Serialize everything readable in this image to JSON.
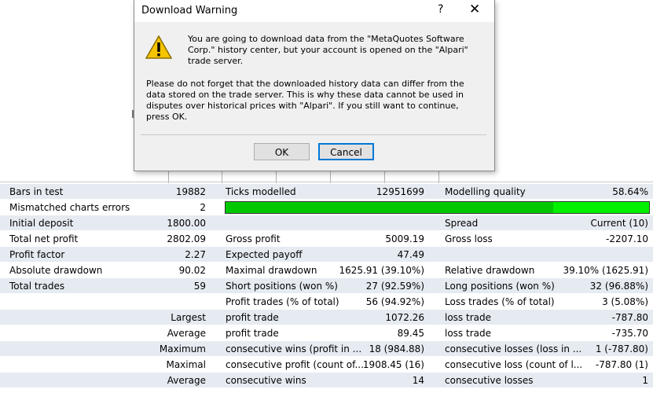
{
  "dialog": {
    "title": "Download Warning",
    "help": "?",
    "close": "✕",
    "message1": "You are going to download data from the \"MetaQuotes Software Corp.\" history center, but your account is opened on the \"Alpari\" trade server.",
    "message2": "Please do not forget that the downloaded history data can differ from the data stored on the trade server. This is why these data cannot be used in disputes over historical prices with \"Alpari\". If you still want to continue, press OK.",
    "ok": "OK",
    "cancel": "Cancel"
  },
  "report": {
    "bars_label": "Bars in test",
    "bars_value": "19882",
    "ticks_label": "Ticks modelled",
    "ticks_value": "12951699",
    "quality_label": "Modelling quality",
    "quality_value": "58.64%",
    "mismatch_label": "Mismatched charts errors",
    "mismatch_value": "2",
    "quality_fill": 0.7744,
    "deposit_label": "Initial deposit",
    "deposit_value": "1800.00",
    "spread_label": "Spread",
    "spread_value": "Current (10)",
    "netprofit_label": "Total net profit",
    "netprofit_value": "2802.09",
    "grossprofit_label": "Gross profit",
    "grossprofit_value": "5009.19",
    "grossloss_label": "Gross loss",
    "grossloss_value": "-2207.10",
    "pf_label": "Profit factor",
    "pf_value": "2.27",
    "ep_label": "Expected payoff",
    "ep_value": "47.49",
    "absdd_label": "Absolute drawdown",
    "absdd_value": "90.02",
    "maxdd_label": "Maximal drawdown",
    "maxdd_value": "1625.91 (39.10%)",
    "reldd_label": "Relative drawdown",
    "reldd_value": "39.10% (1625.91)",
    "trades_label": "Total trades",
    "trades_value": "59",
    "short_label": "Short positions (won %)",
    "short_value": "27 (92.59%)",
    "long_label": "Long positions (won %)",
    "long_value": "32 (96.88%)",
    "pt_label": "Profit trades (% of total)",
    "pt_value": "56 (94.92%)",
    "lt_label": "Loss trades (% of total)",
    "lt_value": "3 (5.08%)",
    "largest": "Largest",
    "largest_pt_label": "profit trade",
    "largest_pt": "1072.26",
    "largest_lt_label": "loss trade",
    "largest_lt": "-787.80",
    "average": "Average",
    "avg_pt_label": "profit trade",
    "avg_pt": "89.45",
    "avg_lt_label": "loss trade",
    "avg_lt": "-735.70",
    "maximum": "Maximum",
    "max_cw_label": "consecutive wins (profit in ...",
    "max_cw": "18 (984.88)",
    "max_cl_label": "consecutive losses (loss in ...",
    "max_cl": "1 (-787.80)",
    "maximal": "Maximal",
    "mx_cp_label": "consecutive profit (count of...",
    "mx_cp": "1908.45 (16)",
    "mx_cl_label": "consecutive loss (count of l...",
    "mx_cl": "-787.80 (1)",
    "average2": "Average",
    "avg_cw_label": "consecutive wins",
    "avg_cw": "14",
    "avg_cl_label": "consecutive losses",
    "avg_cl": "1"
  }
}
